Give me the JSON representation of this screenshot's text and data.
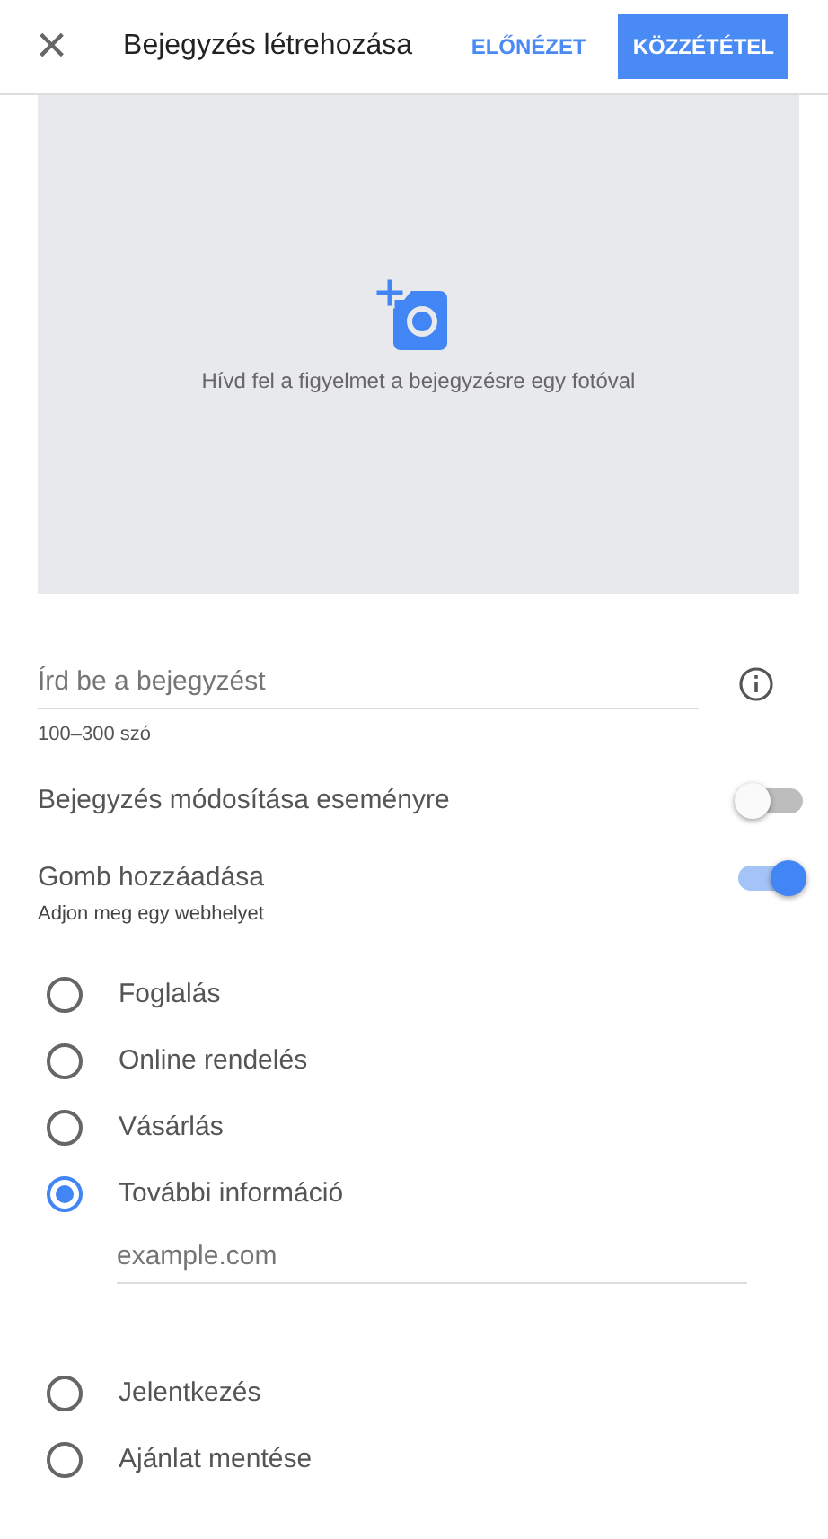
{
  "header": {
    "close": "×",
    "title": "Bejegyzés létrehozása",
    "preview": "ELŐNÉZET",
    "publish": "KÖZZÉTÉTEL"
  },
  "photo": {
    "caption": "Hívd fel a figyelmet a bejegyzésre egy fotóval"
  },
  "post_field": {
    "placeholder": "Írd be a bejegyzést",
    "hint": "100–300 szó"
  },
  "toggles": [
    {
      "label": "Bejegyzés módosítása eseményre",
      "on": false
    },
    {
      "label": "Gomb hozzáadása",
      "on": true,
      "subtitle": "Adjon meg egy webhelyet"
    }
  ],
  "options": [
    {
      "label": "Foglalás",
      "selected": false
    },
    {
      "label": "Online rendelés",
      "selected": false
    },
    {
      "label": "Vásárlás",
      "selected": false
    },
    {
      "label": "További információ",
      "selected": true,
      "field": {
        "placeholder": "example.com"
      }
    },
    {
      "label": "Jelentkezés",
      "selected": false
    },
    {
      "label": "Ajánlat mentése",
      "selected": false
    }
  ]
}
